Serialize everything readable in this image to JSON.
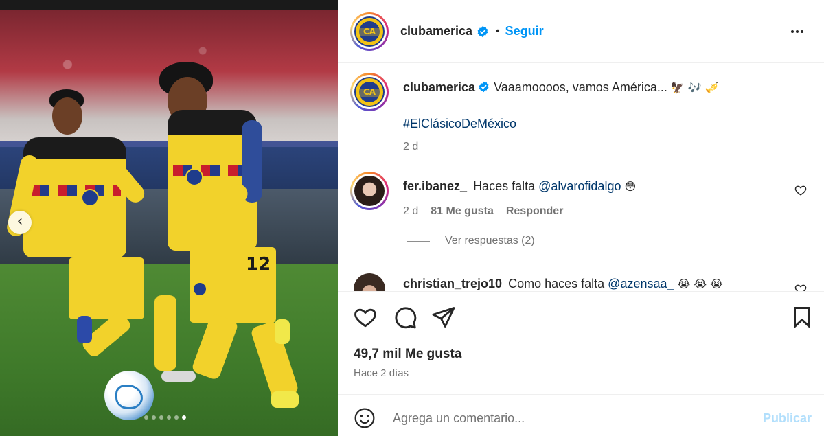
{
  "post": {
    "username": "clubamerica",
    "separator": "•",
    "follow_label": "Seguir",
    "caption_text": "Vaaamoooos, vamos América...",
    "caption_emojis": "🦅 🎶 🎺",
    "hashtag": "#ElClásicoDeMéxico",
    "caption_age": "2 d",
    "avatar_logo_text": "CA"
  },
  "comments": [
    {
      "username": "fer.ibanez_",
      "text": "Haces falta",
      "mention": "@alvarofidalgo",
      "emoji": "😳",
      "age": "2 d",
      "likes": "81 Me gusta",
      "reply_label": "Responder",
      "view_replies": "Ver respuestas (2)"
    },
    {
      "username": "christian_trejo10",
      "text": "Como haces falta",
      "mention": "@azensaa_",
      "emoji": "😭 😭 😭"
    }
  ],
  "stats": {
    "likes": "49,7 mil Me gusta",
    "posted": "Hace 2 días"
  },
  "composer": {
    "placeholder": "Agrega un comentario...",
    "publish_label": "Publicar"
  },
  "media": {
    "carousel_dot_count": 6,
    "active_dot": 6,
    "jersey_number": "12"
  },
  "colors": {
    "accent": "#0095f6",
    "publish_disabled": "#b2dffc",
    "link": "#00376b",
    "muted": "#737373"
  }
}
